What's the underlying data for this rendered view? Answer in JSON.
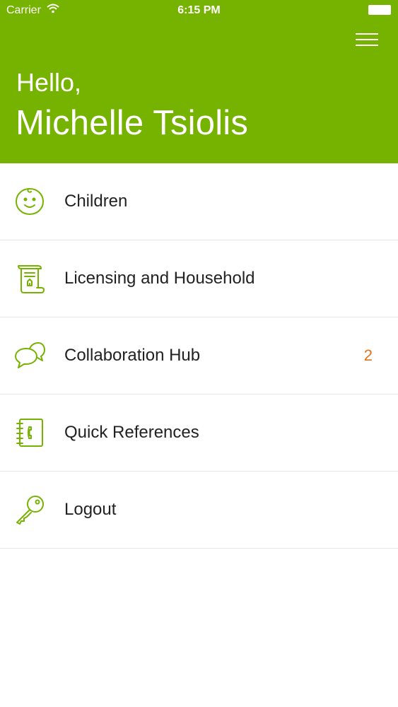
{
  "status_bar": {
    "carrier": "Carrier",
    "time": "6:15 PM"
  },
  "header": {
    "greeting": "Hello,",
    "user_name": "Michelle Tsiolis"
  },
  "menu": {
    "items": [
      {
        "label": "Children",
        "icon": "child-face-icon",
        "badge": ""
      },
      {
        "label": "Licensing and Household",
        "icon": "license-scroll-icon",
        "badge": ""
      },
      {
        "label": "Collaboration Hub",
        "icon": "chat-bubbles-icon",
        "badge": "2"
      },
      {
        "label": "Quick References",
        "icon": "address-book-icon",
        "badge": ""
      },
      {
        "label": "Logout",
        "icon": "key-icon",
        "badge": ""
      }
    ]
  },
  "colors": {
    "brand_green": "#76b301",
    "badge_orange": "#e0731e",
    "icon_green": "#76b301"
  }
}
